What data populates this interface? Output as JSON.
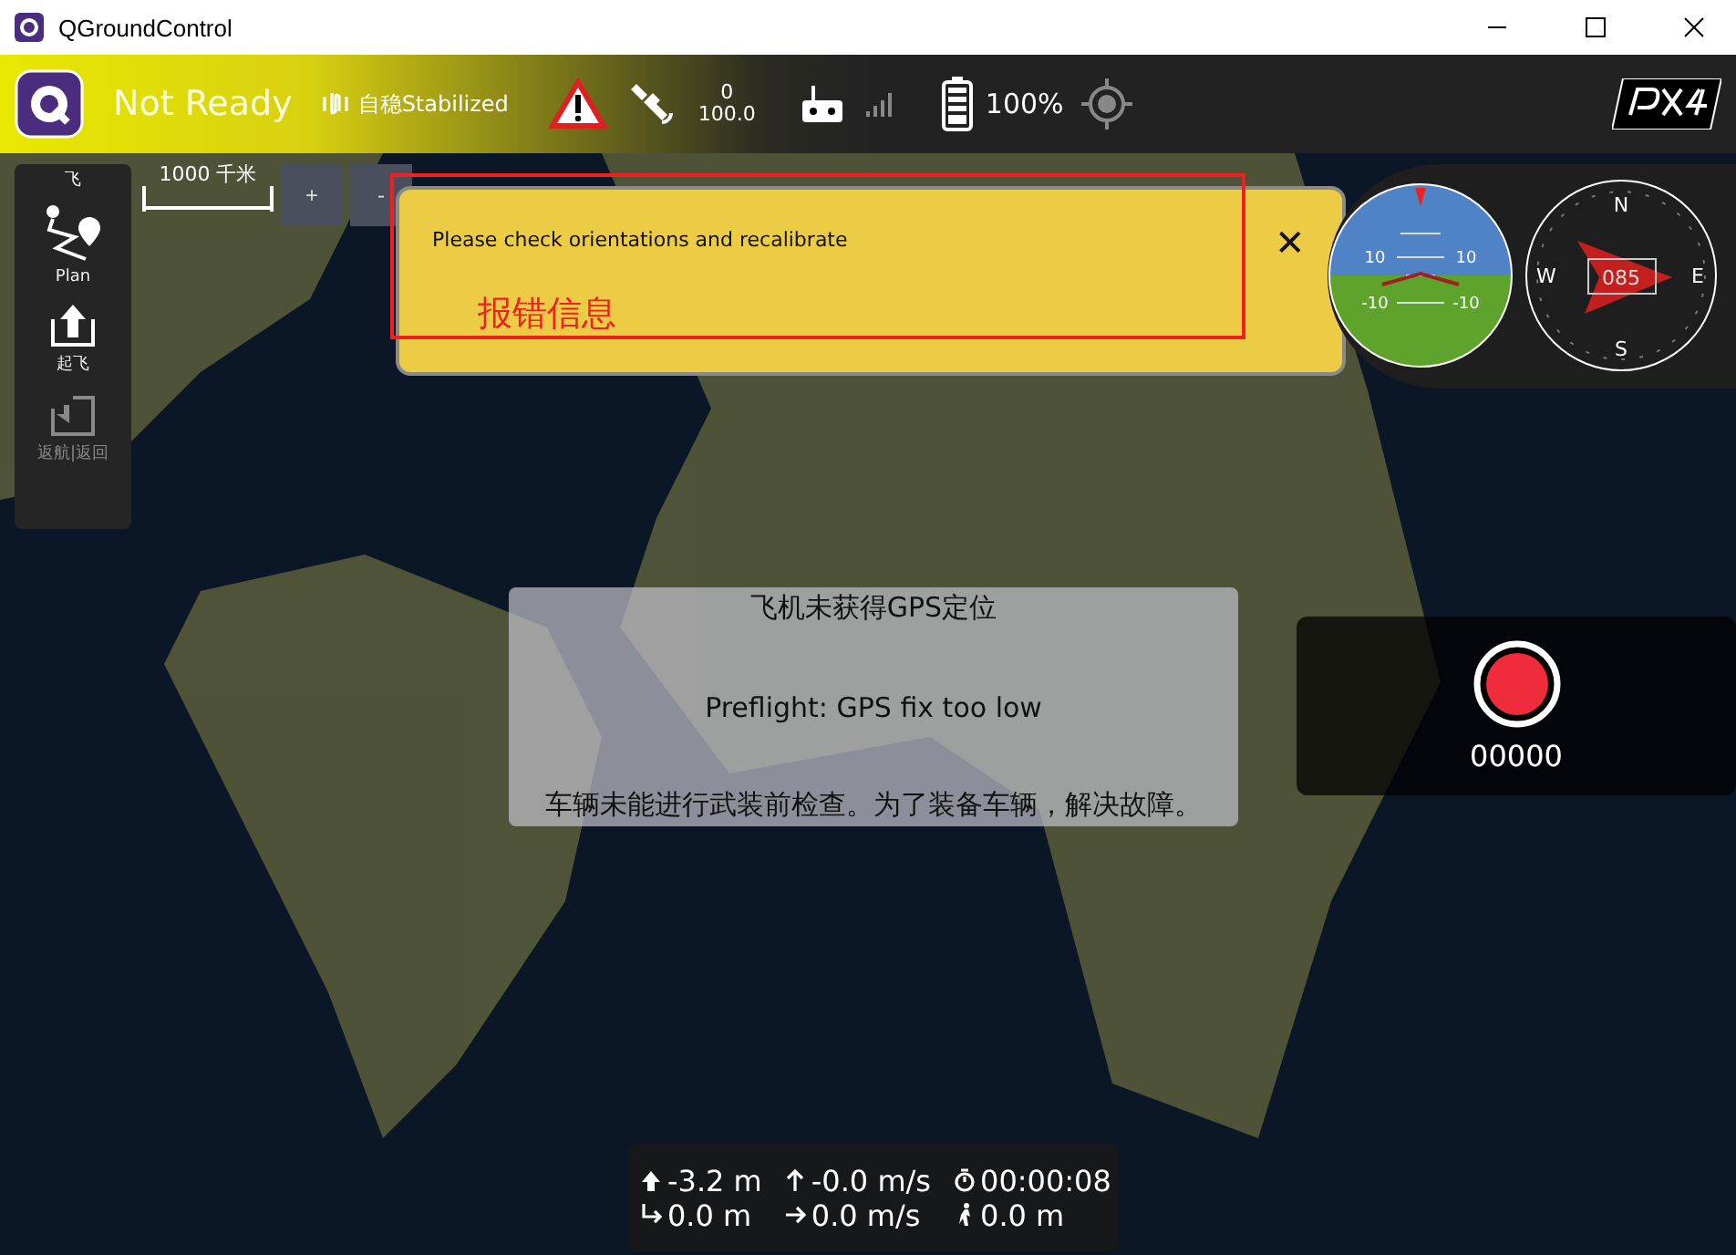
{
  "window": {
    "title": "QGroundControl"
  },
  "toolbar": {
    "status": "Not Ready",
    "flight_mode": "自稳Stabilized",
    "gps": {
      "count": "0",
      "hdop": "100.0"
    },
    "battery": "100%"
  },
  "tools": {
    "header": "飞",
    "items": [
      {
        "kind": "plan",
        "label": "Plan",
        "disabled": false
      },
      {
        "kind": "takeoff",
        "label": "起飞",
        "disabled": false
      },
      {
        "kind": "return",
        "label": "返航|返回",
        "disabled": true
      }
    ]
  },
  "map": {
    "scale": "1000 千米",
    "zoom_buttons": [
      "+",
      "-"
    ]
  },
  "popup": {
    "message": "Please check orientations and recalibrate",
    "close": "✕"
  },
  "annotation": {
    "text": "报错信息"
  },
  "attitude": {
    "labels": [
      "10",
      "10",
      "-10",
      "-10"
    ]
  },
  "compass": {
    "heading": "085",
    "north": "N",
    "east": "E",
    "south": "S",
    "west": "W"
  },
  "preflight": {
    "lines": [
      "飞机未获得GPS定位",
      "Preflight: GPS fix too low",
      "车辆未能进行武装前检查。为了装备车辆，解决故障。"
    ]
  },
  "video": {
    "counter": "00000"
  },
  "telemetry": [
    {
      "kind": "altitude",
      "value": "-3.2 m"
    },
    {
      "kind": "climb",
      "value": "-0.0 m/s"
    },
    {
      "kind": "time",
      "value": "00:00:08"
    },
    {
      "kind": "distance",
      "value": "0.0 m"
    },
    {
      "kind": "speed",
      "value": "0.0 m/s"
    },
    {
      "kind": "home",
      "value": "0.0 m"
    }
  ]
}
